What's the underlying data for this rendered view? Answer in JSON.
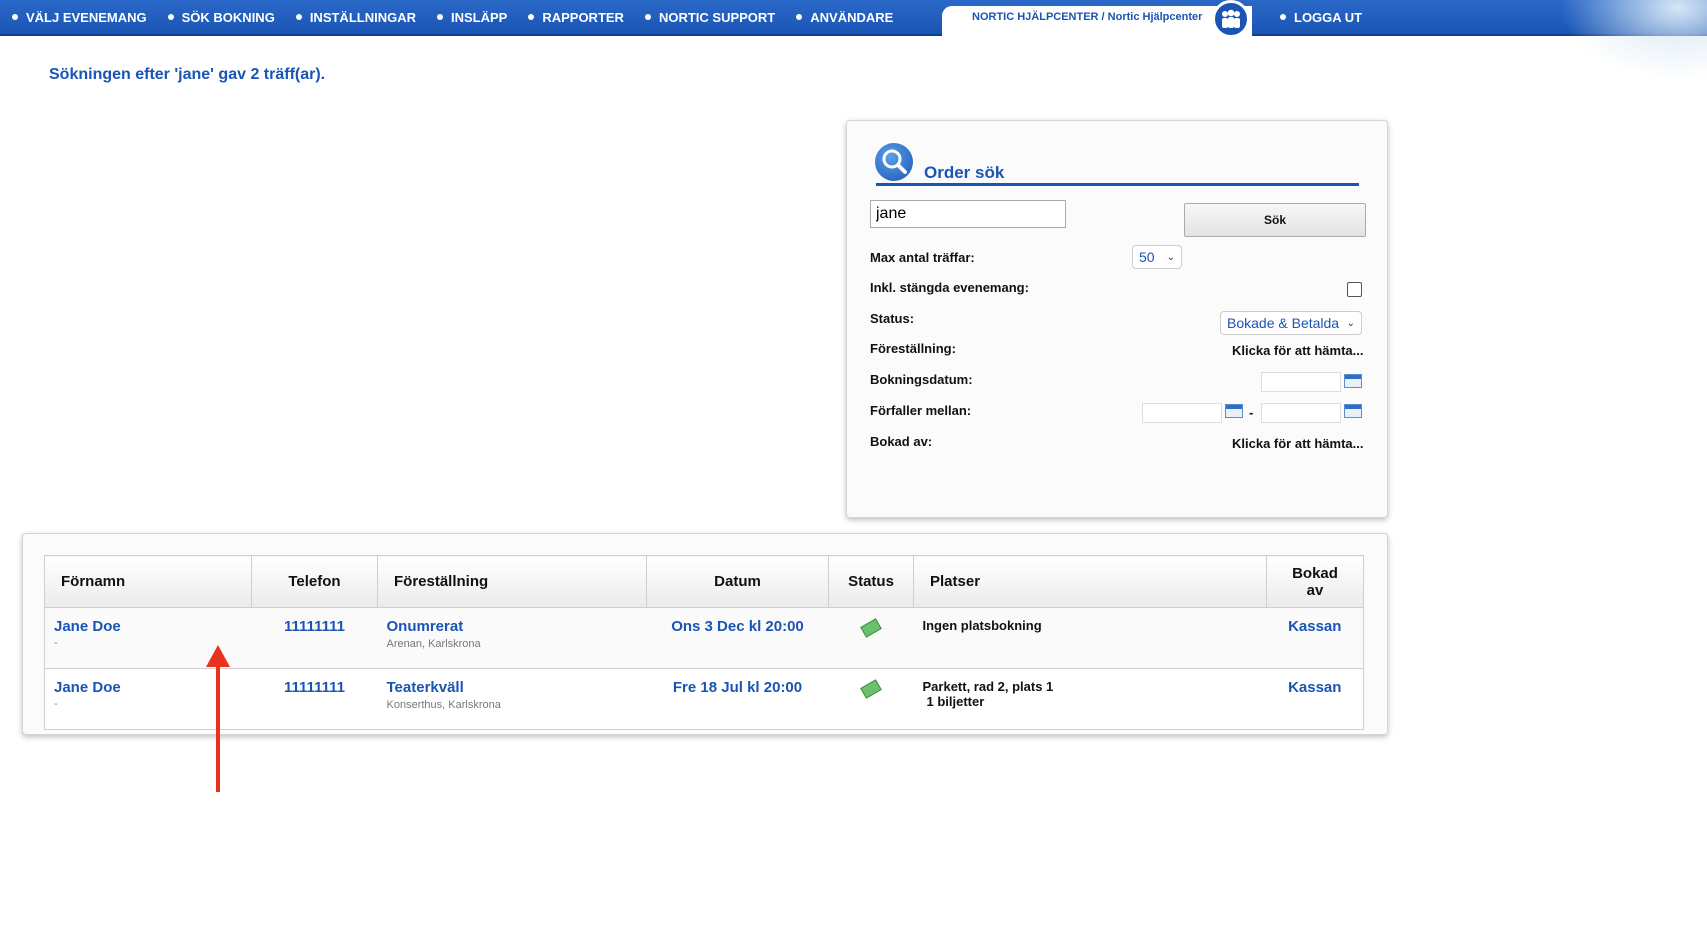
{
  "nav": {
    "items": [
      {
        "label": "VÄLJ EVENEMANG"
      },
      {
        "label": "SÖK BOKNING"
      },
      {
        "label": "INSTÄLLNINGAR"
      },
      {
        "label": "INSLÄPP"
      },
      {
        "label": "RAPPORTER"
      },
      {
        "label": "NORTIC SUPPORT"
      },
      {
        "label": "ANVÄNDARE"
      }
    ],
    "help_center_label": "NORTIC HJÄLPCENTER / Nortic Hjälpcenter",
    "help_icon": "users-icon",
    "logout_label": "LOGGA UT"
  },
  "result_heading": "Sökningen efter 'jane' gav 2 träff(ar).",
  "search": {
    "title": "Order sök",
    "icon": "magnifier-icon",
    "query_value": "jane",
    "search_button": "Sök",
    "max_hits_label": "Max antal träffar:",
    "max_hits_value": "50",
    "include_closed_label": "Inkl. stängda evenemang:",
    "include_closed_checked": false,
    "status_label": "Status:",
    "status_value": "Bokade & Betalda",
    "performance_label": "Föreställning:",
    "performance_value": "Klicka för att hämta...",
    "booking_date_label": "Bokningsdatum:",
    "expires_label": "Förfaller mellan:",
    "range_separator": "-",
    "booked_by_label": "Bokad av:",
    "booked_by_value": "Klicka för att hämta..."
  },
  "results": {
    "columns": [
      "Förnamn",
      "Telefon",
      "Föreställning",
      "Datum",
      "Status",
      "Platser",
      "Bokad av"
    ],
    "rows": [
      {
        "name": "Jane Doe",
        "name_sub": "-",
        "phone": "11111111",
        "show": "Onumrerat",
        "venue": "Arenan, Karlskrona",
        "date": "Ons 3 Dec kl 20:00",
        "status_icon": "money-icon",
        "seats": "Ingen platsbokning",
        "seats_sub": "",
        "booked_by": "Kassan"
      },
      {
        "name": "Jane Doe",
        "name_sub": "-",
        "phone": "11111111",
        "show": "Teaterkväll",
        "venue": "Konserthus, Karlskrona",
        "date": "Fre 18 Jul kl 20:00",
        "status_icon": "money-icon",
        "seats": "Parkett, rad 2, plats 1",
        "seats_sub": "1 biljetter",
        "booked_by": "Kassan"
      }
    ]
  },
  "colors": {
    "accent": "#1a55b4",
    "annotation": "#e8321d"
  }
}
